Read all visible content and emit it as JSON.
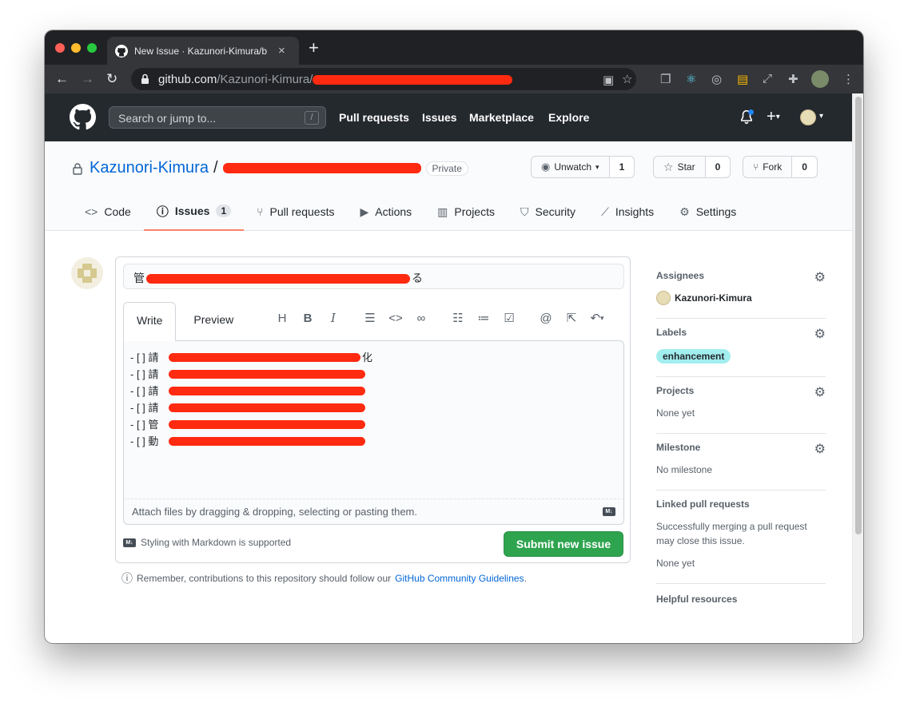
{
  "browser": {
    "tab_title": "New Issue · Kazunori-Kimura/b",
    "url_host": "github.com",
    "url_path": "/Kazunori-Kimura/"
  },
  "header": {
    "search_placeholder": "Search or jump to...",
    "search_key": "/",
    "nav": [
      "Pull requests",
      "Issues",
      "Marketplace",
      "Explore"
    ]
  },
  "repo": {
    "owner": "Kazunori-Kimura",
    "separator": "/",
    "visibility": "Private",
    "watch_label": "Unwatch",
    "watch_count": "1",
    "star_label": "Star",
    "star_count": "0",
    "fork_label": "Fork",
    "fork_count": "0",
    "tabs": [
      {
        "label": "Code"
      },
      {
        "label": "Issues",
        "count": "1"
      },
      {
        "label": "Pull requests"
      },
      {
        "label": "Actions"
      },
      {
        "label": "Projects"
      },
      {
        "label": "Security"
      },
      {
        "label": "Insights"
      },
      {
        "label": "Settings"
      }
    ]
  },
  "issue": {
    "title_prefix": "管",
    "title_suffix": "る",
    "write_tab": "Write",
    "preview_tab": "Preview",
    "lines": [
      {
        "prefix": "- [ ] 請",
        "suffix": "化"
      },
      {
        "prefix": "- [ ] 請",
        "suffix": ""
      },
      {
        "prefix": "- [ ] 請",
        "suffix": ""
      },
      {
        "prefix": "- [ ] 請",
        "suffix": ""
      },
      {
        "prefix": "- [ ] 管",
        "suffix": ""
      },
      {
        "prefix": "- [ ] 動",
        "suffix": ""
      }
    ],
    "attach_hint": "Attach files by dragging & dropping, selecting or pasting them.",
    "markdown_note": "Styling with Markdown is supported",
    "submit_label": "Submit new issue",
    "remember_text": "Remember, contributions to this repository should follow our",
    "guidelines_link": "GitHub Community Guidelines",
    "remember_end": "."
  },
  "sidebar": {
    "assignees_head": "Assignees",
    "assignee": "Kazunori-Kimura",
    "labels_head": "Labels",
    "label": "enhancement",
    "label_color": "#a2eeef",
    "projects_head": "Projects",
    "projects_val": "None yet",
    "milestone_head": "Milestone",
    "milestone_val": "No milestone",
    "linked_head": "Linked pull requests",
    "linked_desc": "Successfully merging a pull request may close this issue.",
    "linked_val": "None yet",
    "helpful_head": "Helpful resources"
  },
  "colors": {
    "accent_link": "#0366d6",
    "submit_green": "#2ea44f",
    "header_dark": "#24292e",
    "active_tab_underline": "#f9826c",
    "redaction_red": "#ff2a10"
  }
}
